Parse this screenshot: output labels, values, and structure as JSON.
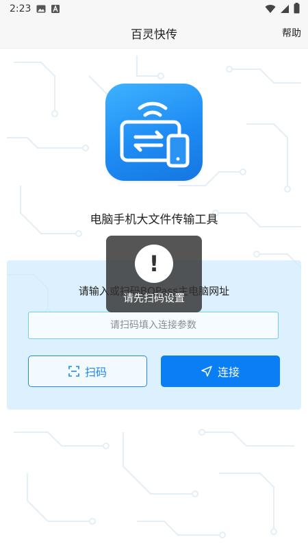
{
  "status_bar": {
    "time": "2:23",
    "left_icons": [
      "image-icon",
      "a-icon"
    ],
    "right_icons": [
      "wifi-icon",
      "signal-icon",
      "battery-icon"
    ]
  },
  "app_bar": {
    "title": "百灵快传",
    "help_label": "帮助"
  },
  "hero": {
    "logo_icon": "transfer-app-logo-icon",
    "subtitle": "电脑手机大文件传输工具"
  },
  "form": {
    "prompt": "请输入或扫码BQPass主电脑网址",
    "input_value": "",
    "input_placeholder": "请扫码填入连接参数",
    "scan_button_label": "扫码",
    "scan_icon": "scan-icon",
    "connect_button_label": "连接",
    "connect_icon": "send-icon"
  },
  "toast": {
    "icon": "exclamation-icon",
    "message": "请先扫码设置"
  },
  "colors": {
    "primary": "#0a7ff5",
    "card_bg": "#d2ebfc",
    "input_border": "#6ed0e0",
    "toast_bg": "#303030"
  }
}
